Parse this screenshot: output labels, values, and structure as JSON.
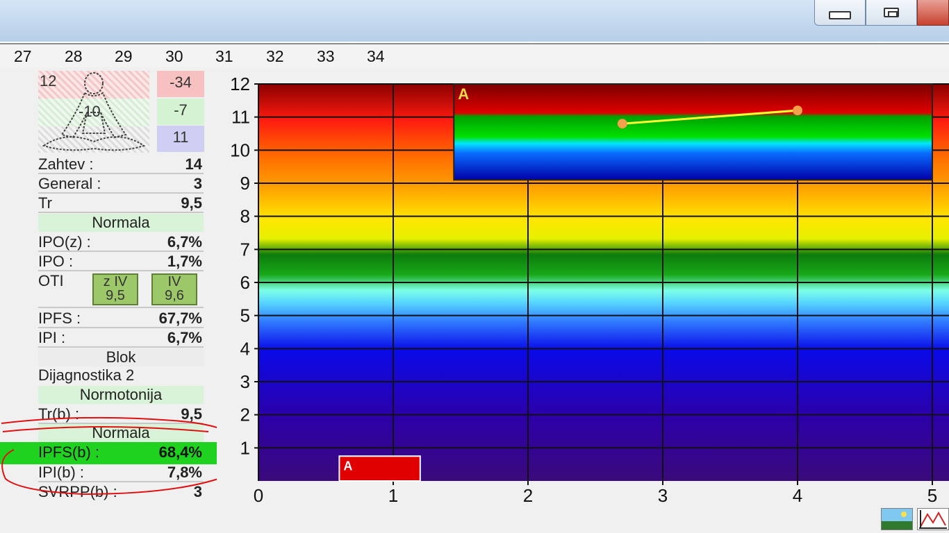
{
  "ruler_numbers": [
    "27",
    "28",
    "29",
    "30",
    "31",
    "32",
    "33",
    "34"
  ],
  "person": {
    "top_left": "12",
    "center": "-10"
  },
  "side_values": {
    "red": "-34",
    "green": "-7",
    "blue": "11"
  },
  "rows": {
    "zahtev": {
      "label": "Zahtev :",
      "value": "14"
    },
    "general": {
      "label": "General :",
      "value": "3"
    },
    "tr": {
      "label": "Tr",
      "value": "9,5"
    },
    "normala1": "Normala",
    "ipoz": {
      "label": "IPO(z) :",
      "value": "6,7%"
    },
    "ipo": {
      "label": "IPO :",
      "value": "1,7%"
    },
    "oti": {
      "label": "OTI"
    },
    "oti_box1": {
      "line1": "z  IV",
      "line2": "9,5"
    },
    "oti_box2": {
      "line1": "IV",
      "line2": "9,6"
    },
    "ipfs": {
      "label": "IPFS :",
      "value": "67,7%"
    },
    "ipi": {
      "label": "IPI :",
      "value": "6,7%"
    },
    "blok": "Blok",
    "dijagnostika": "Dijagnostika 2",
    "normotonija": "Normotonija",
    "trb": {
      "label": "Tr(b) :",
      "value": "9,5"
    },
    "normala2": "Normala",
    "ipfsb": {
      "label": "IPFS(b) :",
      "value": "68,4%"
    },
    "ipib": {
      "label": "IPI(b) :",
      "value": "7,8%"
    },
    "svrppb": {
      "label": "SVRPP(b) :",
      "value": "3"
    }
  },
  "colors": {
    "highlight": "#1fd21f",
    "annotation": "#e01010",
    "panel_bg": "#f0f0f0"
  },
  "chart_data": {
    "type": "line",
    "title": "",
    "xlabel": "",
    "ylabel": "",
    "xlim": [
      0,
      5
    ],
    "ylim": [
      0,
      12
    ],
    "x_ticks": [
      "0",
      "1",
      "2",
      "3",
      "4",
      "5"
    ],
    "y_ticks": [
      "1",
      "2",
      "3",
      "4",
      "5",
      "6",
      "7",
      "8",
      "9",
      "10",
      "11",
      "12"
    ],
    "grid": true,
    "background": "vertical rainbow gradient (purple at bottom to dark red at top)",
    "series": [
      {
        "x": [
          2.7,
          4.0
        ],
        "y": [
          10.8,
          11.2
        ],
        "color": "#ffff33"
      }
    ],
    "insets": [
      {
        "label": "A",
        "x_range": [
          1.45,
          5
        ],
        "y_range": [
          9.1,
          12
        ],
        "band_colors": [
          "#b40000",
          "#00c800",
          "#00d8ff",
          "#0033dd"
        ]
      },
      {
        "label": "A",
        "x_range": [
          0.6,
          1.2
        ],
        "y_range": [
          0,
          0.75
        ],
        "band_colors": [
          "#e00000"
        ]
      }
    ]
  }
}
